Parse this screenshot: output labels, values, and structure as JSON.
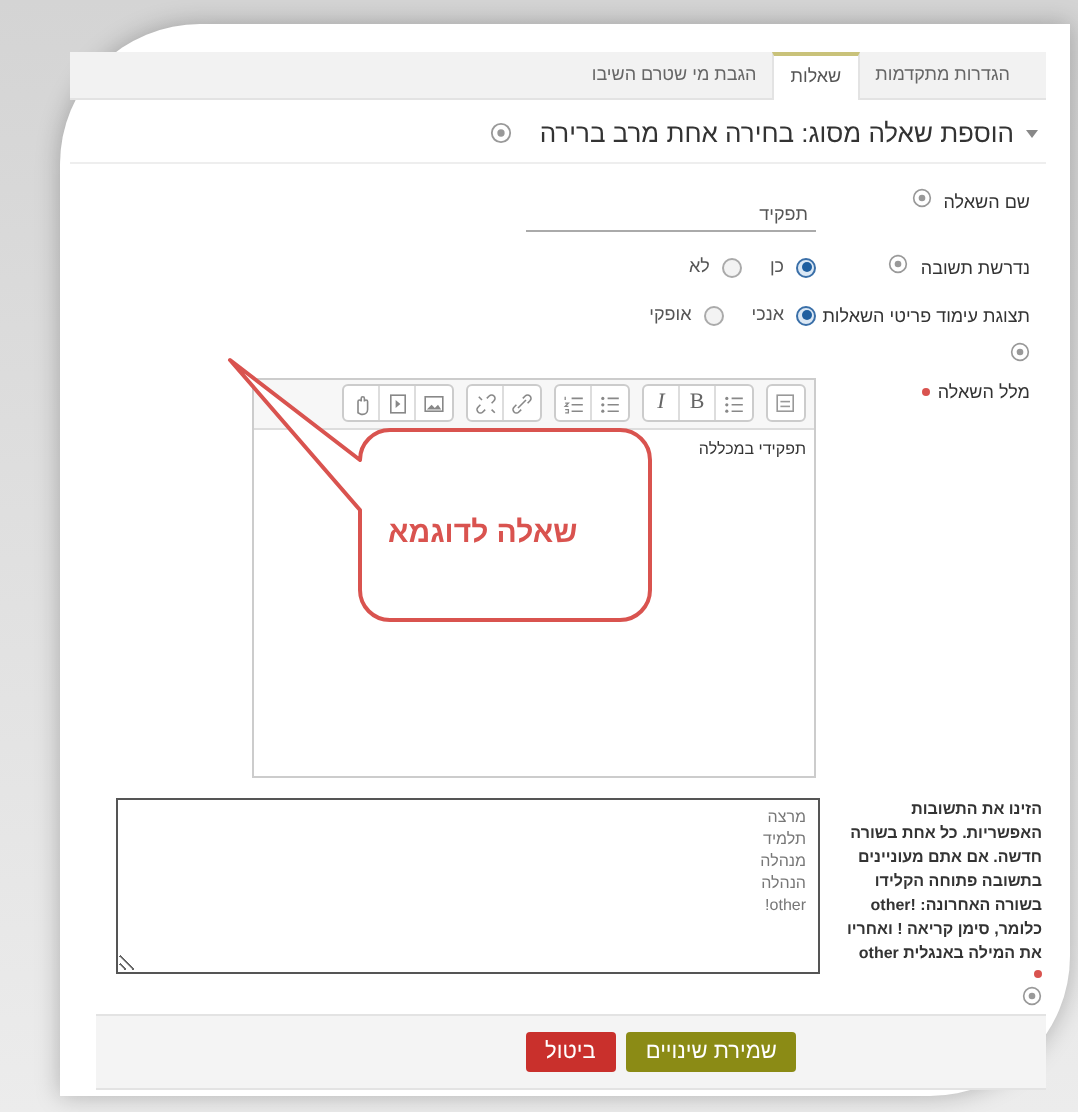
{
  "tabs": [
    {
      "label": "הגדרות מתקדמות",
      "selected": false
    },
    {
      "label": "שאלות",
      "selected": true
    },
    {
      "label": "הגבת מי שטרם השיבו",
      "selected": false
    }
  ],
  "heading": "הוספת שאלה מסוג: בחירה אחת מרב ברירה",
  "question_name": {
    "label": "שם השאלה",
    "value": "תפקיד"
  },
  "required_answer": {
    "label": "נדרשת תשובה",
    "options": [
      {
        "label": "כן",
        "selected": true
      },
      {
        "label": "לא",
        "selected": false
      }
    ]
  },
  "layout_display": {
    "label": "תצוגת עימוד פריטי השאלות",
    "options": [
      {
        "label": "אנכי",
        "selected": true
      },
      {
        "label": "אופקי",
        "selected": false
      }
    ]
  },
  "question_text": {
    "label": "מלל השאלה",
    "required": true,
    "toolbar": {
      "bold": "B",
      "italic": "I"
    },
    "content": "תפקידי במכללה"
  },
  "answers": {
    "help": "הזינו את התשובות האפשריות. כל אחת בשורה חדשה. אם אתם מעוניינים בתשובה פתוחה הקלידו בשורה האחרונה: **!other** כלומר, סימן קריאה ! ואחריו את המילה באנגלית **other**",
    "required": true,
    "value": "מרצה\nתלמיד\nמנהלה\nהנהלה\nother!"
  },
  "buttons": {
    "save": "שמירת שינויים",
    "cancel": "ביטול"
  },
  "callout": "שאלה לדוגמא"
}
